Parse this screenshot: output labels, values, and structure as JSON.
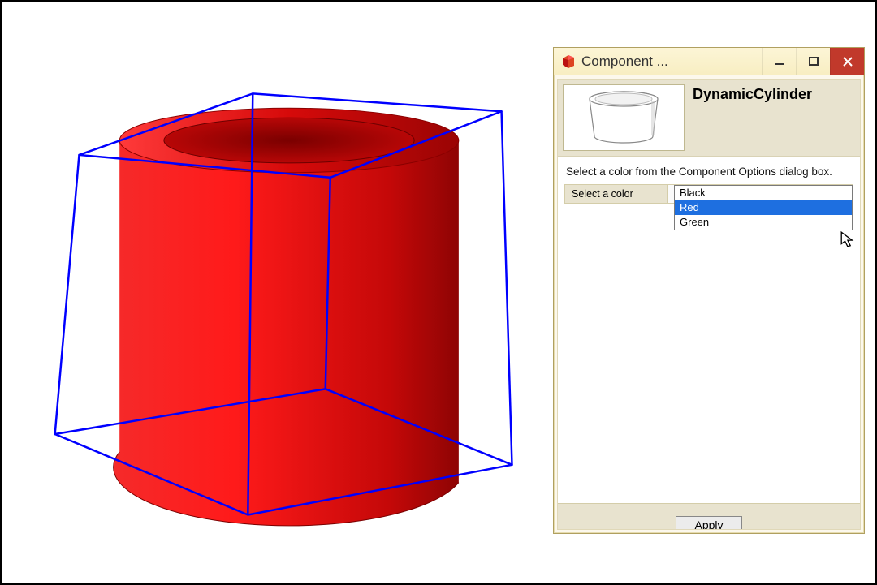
{
  "window": {
    "title": "Component ...",
    "component_name": "DynamicCylinder",
    "description": "Select a color from the Component Options dialog box.",
    "field_label": "Select a color",
    "options": [
      "Black",
      "Red",
      "Green"
    ],
    "selected_index": 1,
    "apply_label": "Apply"
  },
  "colors": {
    "cylinder": "#e30613",
    "selection_box": "#0000ff",
    "highlight": "#1e6fe0",
    "close_btn": "#c1392b",
    "dialog_bg": "#fcf8ec"
  }
}
